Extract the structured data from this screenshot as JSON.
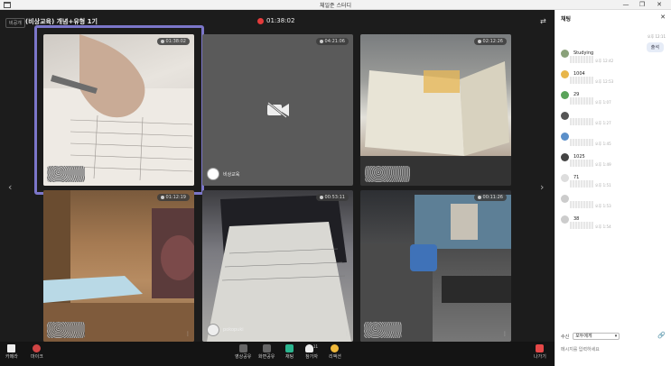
{
  "window": {
    "title": "체일준 스터디",
    "min": "—",
    "max": "❐",
    "close": "✕"
  },
  "room": {
    "tag": "비공개",
    "name": "(비상교육) 개념+유형 1기",
    "elapsed": "01:38:02"
  },
  "tiles": [
    {
      "timer": "01:38:02",
      "name": ""
    },
    {
      "timer": "04:21:06",
      "name": "비상교육"
    },
    {
      "timer": "02:12:26",
      "name": ""
    },
    {
      "timer": "01:12:19",
      "name": ""
    },
    {
      "timer": "00:53:11",
      "name": "pokopuki"
    },
    {
      "timer": "00:11:26",
      "name": ""
    }
  ],
  "toolbar": {
    "camera": "카메라",
    "mic": "마이크",
    "screen_share": "영상공유",
    "screen_share2": "화면공유",
    "chat": "채팅",
    "participants": "참가자",
    "participants_count": "11",
    "reaction": "리액션",
    "leave": "나가기"
  },
  "chat": {
    "title": "채팅",
    "my_time": "오후 12:11",
    "my_message": "출석",
    "messages": [
      {
        "name": "Studying",
        "time": "오후 12:42",
        "color": "#8aa17a"
      },
      {
        "name": "1004",
        "time": "오후 12:53",
        "color": "#e8b64a"
      },
      {
        "name": "29",
        "time": "오후 1:07",
        "color": "#5aa35a"
      },
      {
        "name": "",
        "time": "오후 1:27",
        "color": "#555555"
      },
      {
        "name": "",
        "time": "오후 1:45",
        "color": "#5b8fc9"
      },
      {
        "name": "1025",
        "time": "오후 1:49",
        "color": "#444444"
      },
      {
        "name": "71",
        "time": "오후 1:51",
        "color": "#dddddd"
      },
      {
        "name": "",
        "time": "오후 1:53",
        "color": "#cccccc"
      },
      {
        "name": "38",
        "time": "오후 1:54",
        "color": "#cccccc"
      }
    ],
    "receiver_label": "수신",
    "receiver_value": "모두에게",
    "input_placeholder": "메시지를 입력하세요"
  }
}
